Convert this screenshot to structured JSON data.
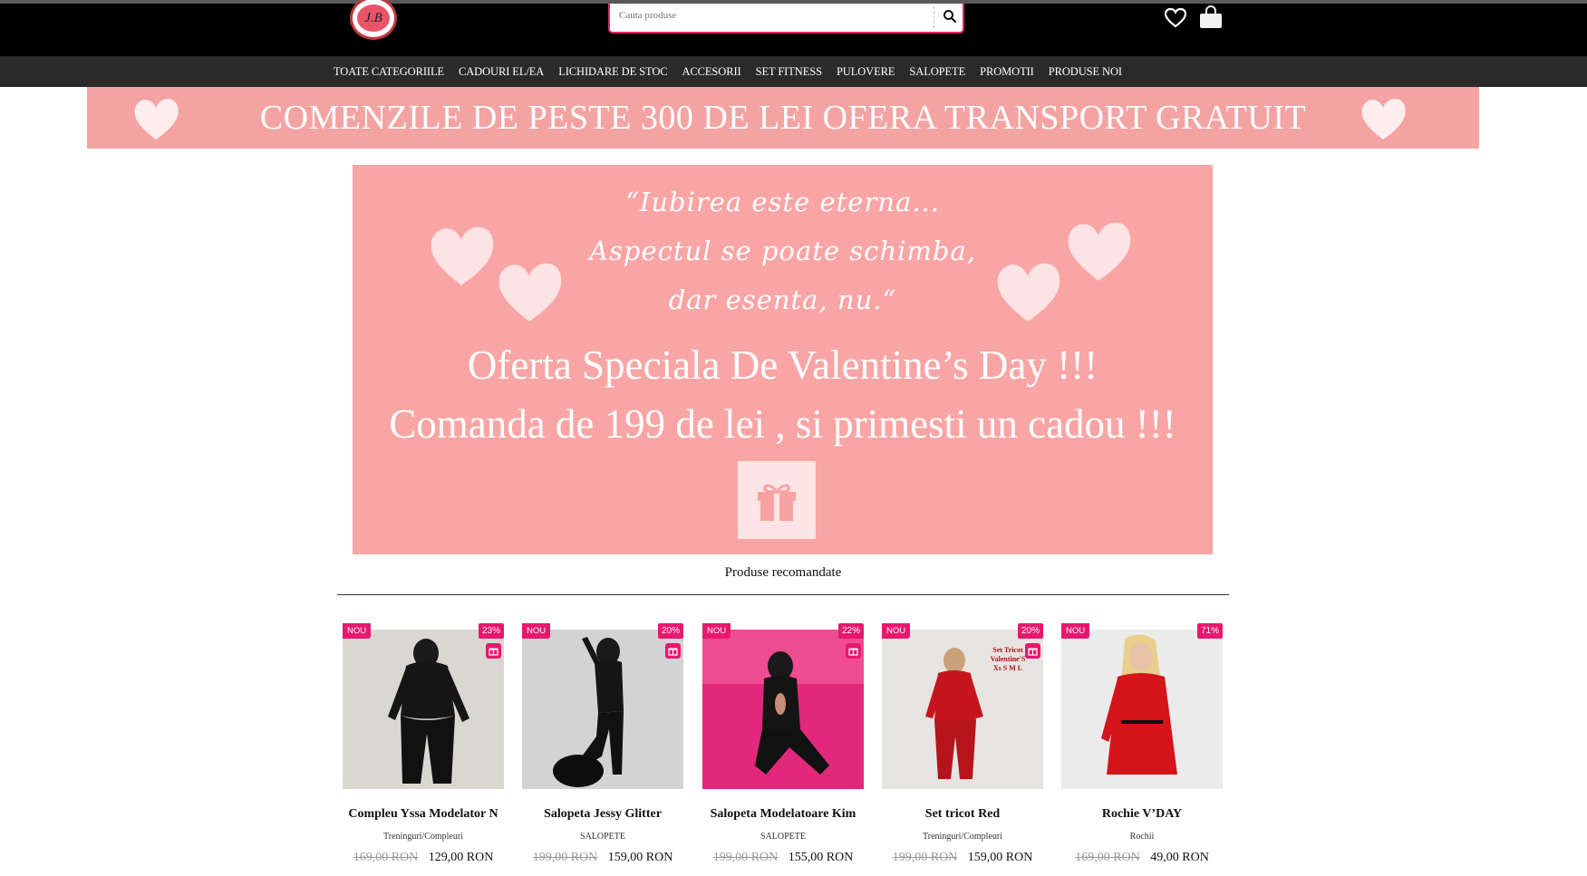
{
  "header": {
    "logo_text": "J.B",
    "search_placeholder": "Cauta produse"
  },
  "nav": {
    "items": [
      "TOATE CATEGORIILE",
      "CADOURI EL/EA",
      "LICHIDARE DE STOC",
      "ACCESORII",
      "SET FITNESS",
      "PULOVERE",
      "SALOPETE",
      "PROMOTII",
      "PRODUSE NOI"
    ]
  },
  "promo": {
    "text": "COMENZILE DE PESTE 300 DE LEI OFERA TRANSPORT GRATUIT"
  },
  "hero": {
    "quote_line1": "“Iubirea este eterna...",
    "quote_line2": "Aspectul se poate schimba,",
    "quote_line3": "dar esenta, nu.“",
    "title_line1": "Oferta Speciala De Valentine’s Day !!!",
    "title_line2": "Comanda de 199 de lei , si primesti un cadou !!!"
  },
  "section": {
    "title": "Produse recomandate"
  },
  "products": [
    {
      "badge": "NOU",
      "discount": "23%",
      "name": "Compleu Yssa Modelator N",
      "category": "Treninguri/Compleuri",
      "old_price": "169,00 RON",
      "price": "129,00 RON",
      "bg": "#d9d6d2"
    },
    {
      "badge": "NOU",
      "discount": "20%",
      "name": "Salopeta Jessy Glitter",
      "category": "SALOPETE",
      "old_price": "199,00 RON",
      "price": "159,00 RON",
      "bg": "#cfd0cf"
    },
    {
      "badge": "NOU",
      "discount": "22%",
      "name": "Salopeta Modelatoare Kim",
      "category": "SALOPETE",
      "old_price": "199,00 RON",
      "price": "155,00 RON",
      "bg": "#e0247a"
    },
    {
      "badge": "NOU",
      "discount": "20%",
      "name": "Set tricot Red",
      "category": "Treninguri/Compleuri",
      "old_price": "199,00 RON",
      "price": "159,00 RON",
      "bg": "#e4e2df"
    },
    {
      "badge": "NOU",
      "discount": "71%",
      "name": "Rochie V’DAY",
      "category": "Rochii",
      "old_price": "169,00 RON",
      "price": "49,00 RON",
      "bg": "#e9e9ea"
    }
  ],
  "product4_overlay": {
    "line1": "Set Tricot",
    "line2": "Valentine'S",
    "line3": "Xs S M L"
  }
}
